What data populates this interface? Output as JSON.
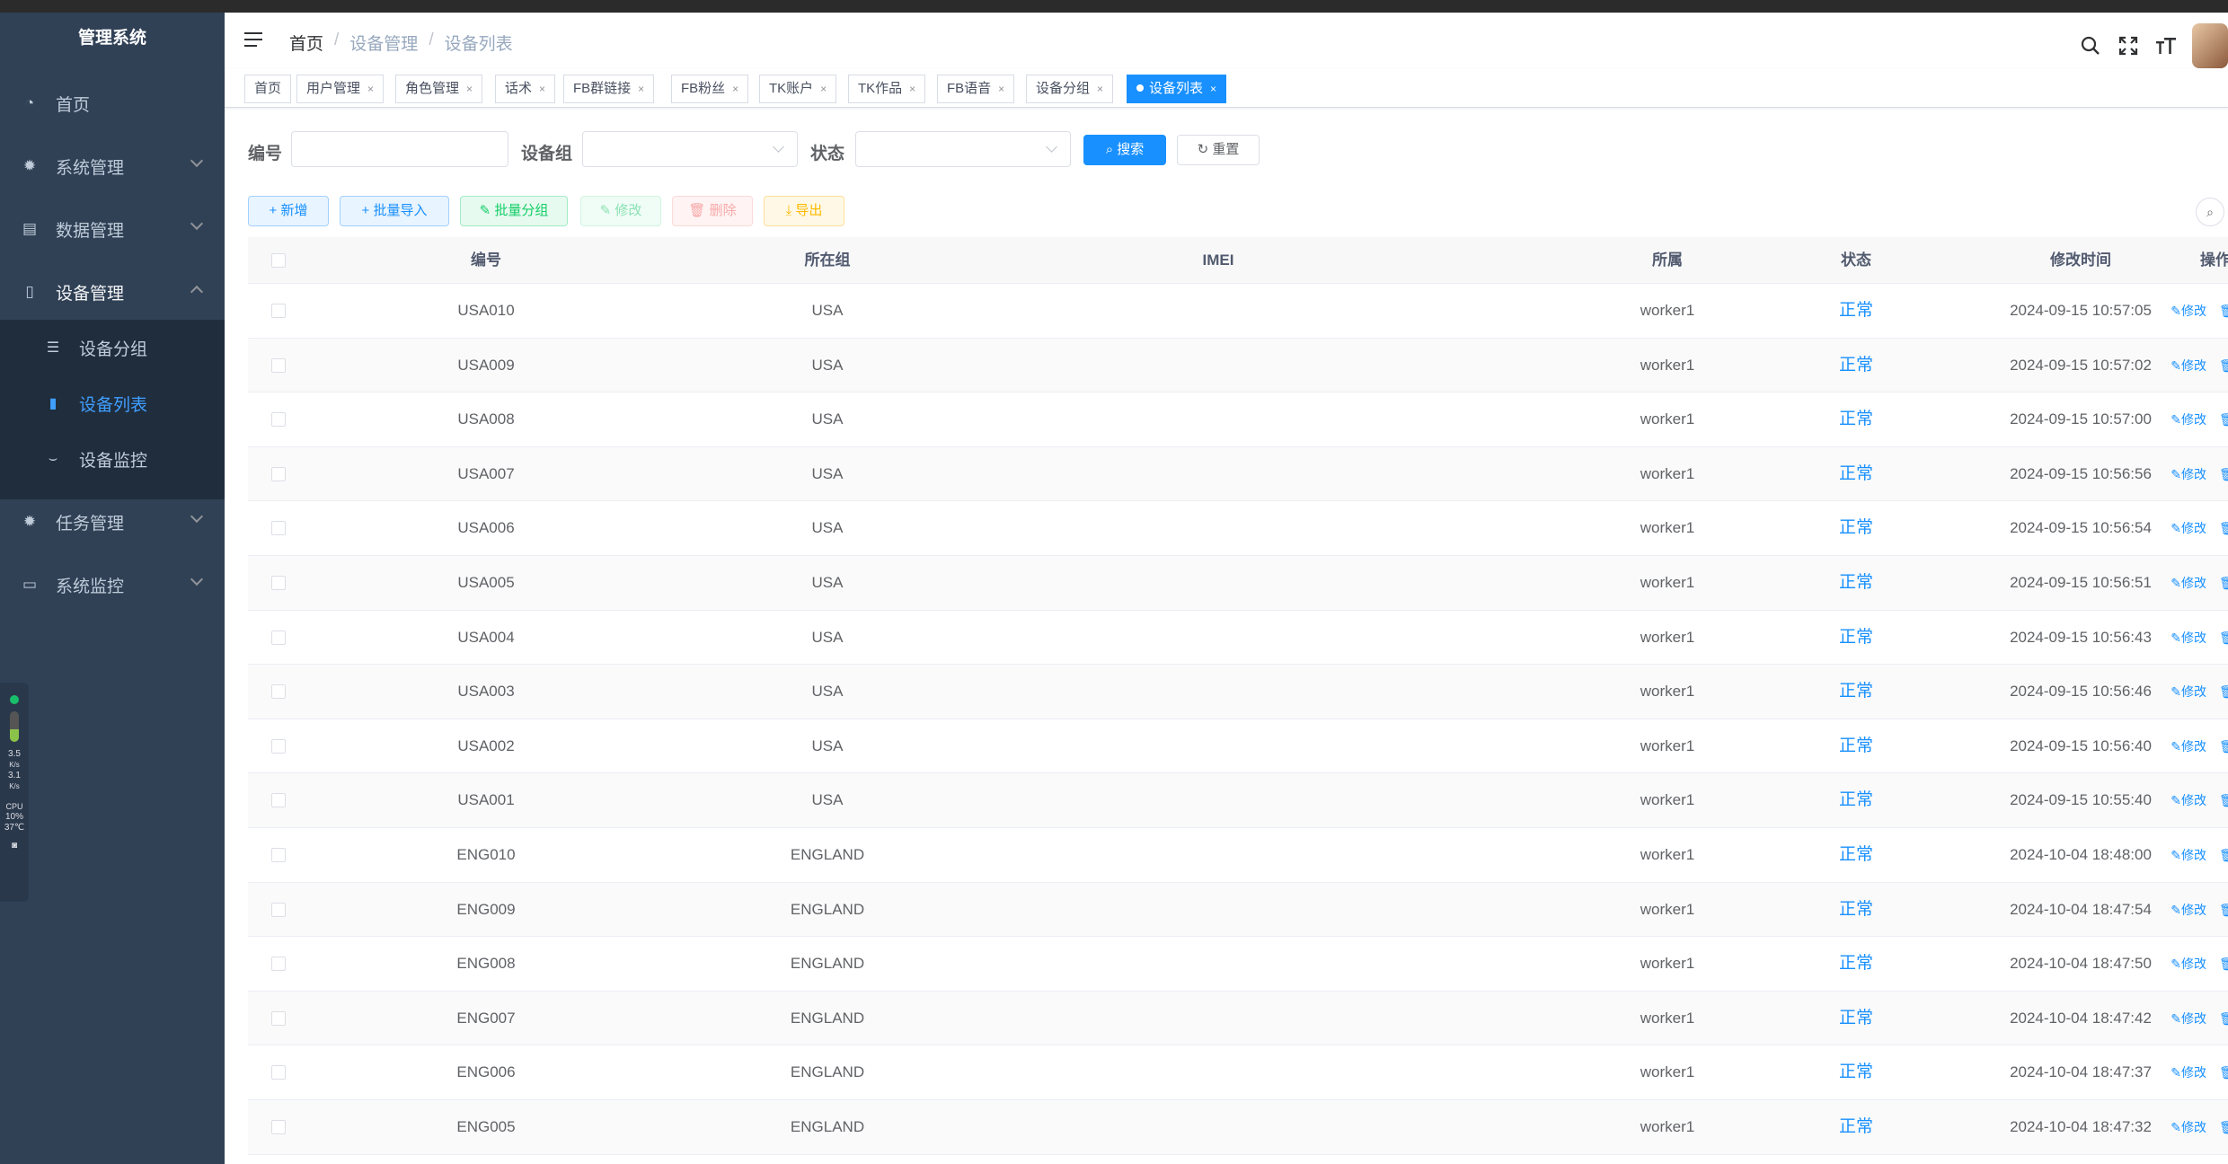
{
  "app": {
    "title": "管理系统"
  },
  "sidebar": {
    "items": [
      {
        "label": "首页",
        "icon": "dashboard-icon"
      },
      {
        "label": "系统管理",
        "icon": "gear-icon"
      },
      {
        "label": "数据管理",
        "icon": "database-icon"
      },
      {
        "label": "设备管理",
        "icon": "phone-icon"
      },
      {
        "label": "任务管理",
        "icon": "gear-icon"
      },
      {
        "label": "系统监控",
        "icon": "monitor-icon"
      }
    ],
    "sub_items": [
      {
        "label": "设备分组",
        "icon": "list-icon"
      },
      {
        "label": "设备列表",
        "icon": "device-icon"
      },
      {
        "label": "设备监控",
        "icon": "eye-icon"
      }
    ]
  },
  "widget": {
    "up": "3.5",
    "up_unit": "K/s",
    "down": "3.1",
    "down_unit": "K/s",
    "cpu_label": "CPU",
    "cpu": "10%",
    "temp": "37℃"
  },
  "header": {
    "breadcrumb": [
      "首页",
      "设备管理",
      "设备列表"
    ]
  },
  "tags": [
    "首页",
    "用户管理",
    "角色管理",
    "话术",
    "FB群链接",
    "FB粉丝",
    "TK账户",
    "TK作品",
    "FB语音",
    "设备分组",
    "设备列表"
  ],
  "search": {
    "code_label": "编号",
    "code_value": "",
    "group_label": "设备组",
    "group_value": "",
    "status_label": "状态",
    "status_value": "",
    "search_btn": "搜索",
    "reset_btn": "重置"
  },
  "toolbar": {
    "add": "新增",
    "batch_import": "批量导入",
    "batch_group": "批量分组",
    "edit": "修改",
    "delete": "删除",
    "export": "导出"
  },
  "table": {
    "columns": [
      "编号",
      "所在组",
      "IMEI",
      "所属",
      "状态",
      "修改时间",
      "操作"
    ],
    "edit_label": "修改",
    "delete_label": "删除",
    "rows": [
      {
        "code": "USA010",
        "group": "USA",
        "imei": "",
        "owner": "worker1",
        "status": "正常",
        "time": "2024-09-15 10:57:05"
      },
      {
        "code": "USA009",
        "group": "USA",
        "imei": "",
        "owner": "worker1",
        "status": "正常",
        "time": "2024-09-15 10:57:02"
      },
      {
        "code": "USA008",
        "group": "USA",
        "imei": "",
        "owner": "worker1",
        "status": "正常",
        "time": "2024-09-15 10:57:00"
      },
      {
        "code": "USA007",
        "group": "USA",
        "imei": "",
        "owner": "worker1",
        "status": "正常",
        "time": "2024-09-15 10:56:56"
      },
      {
        "code": "USA006",
        "group": "USA",
        "imei": "",
        "owner": "worker1",
        "status": "正常",
        "time": "2024-09-15 10:56:54"
      },
      {
        "code": "USA005",
        "group": "USA",
        "imei": "",
        "owner": "worker1",
        "status": "正常",
        "time": "2024-09-15 10:56:51"
      },
      {
        "code": "USA004",
        "group": "USA",
        "imei": "",
        "owner": "worker1",
        "status": "正常",
        "time": "2024-09-15 10:56:43"
      },
      {
        "code": "USA003",
        "group": "USA",
        "imei": "",
        "owner": "worker1",
        "status": "正常",
        "time": "2024-09-15 10:56:46"
      },
      {
        "code": "USA002",
        "group": "USA",
        "imei": "",
        "owner": "worker1",
        "status": "正常",
        "time": "2024-09-15 10:56:40"
      },
      {
        "code": "USA001",
        "group": "USA",
        "imei": "",
        "owner": "worker1",
        "status": "正常",
        "time": "2024-09-15 10:55:40"
      },
      {
        "code": "ENG010",
        "group": "ENGLAND",
        "imei": "",
        "owner": "worker1",
        "status": "正常",
        "time": "2024-10-04 18:48:00"
      },
      {
        "code": "ENG009",
        "group": "ENGLAND",
        "imei": "",
        "owner": "worker1",
        "status": "正常",
        "time": "2024-10-04 18:47:54"
      },
      {
        "code": "ENG008",
        "group": "ENGLAND",
        "imei": "",
        "owner": "worker1",
        "status": "正常",
        "time": "2024-10-04 18:47:50"
      },
      {
        "code": "ENG007",
        "group": "ENGLAND",
        "imei": "",
        "owner": "worker1",
        "status": "正常",
        "time": "2024-10-04 18:47:42"
      },
      {
        "code": "ENG006",
        "group": "ENGLAND",
        "imei": "",
        "owner": "worker1",
        "status": "正常",
        "time": "2024-10-04 18:47:37"
      },
      {
        "code": "ENG005",
        "group": "ENGLAND",
        "imei": "",
        "owner": "worker1",
        "status": "正常",
        "time": "2024-10-04 18:47:32"
      }
    ]
  },
  "colors": {
    "sidebar_bg": "#304156",
    "submenu_bg": "#1f2d3d",
    "accent": "#1890ff"
  }
}
